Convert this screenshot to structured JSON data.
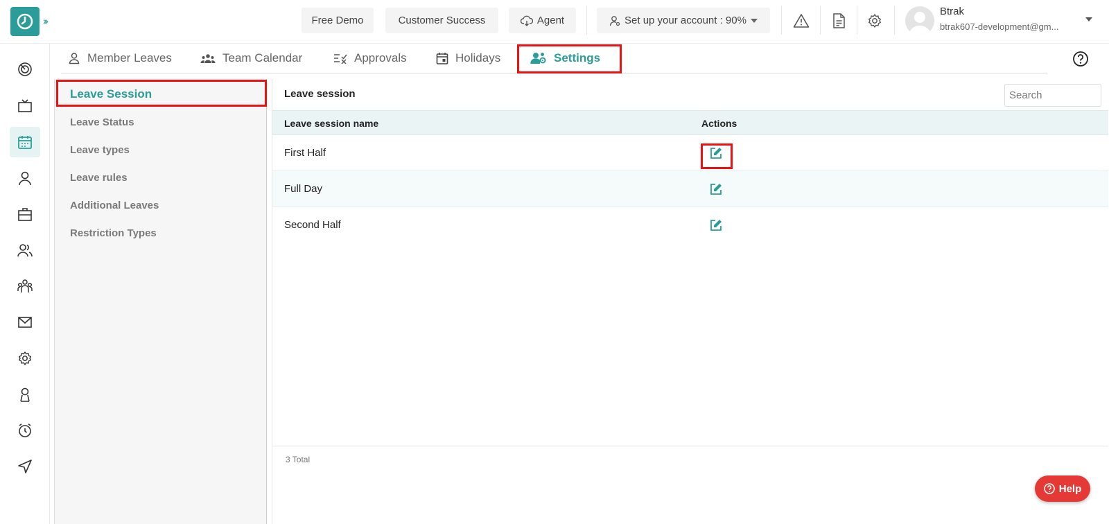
{
  "topbar": {
    "free_demo": "Free Demo",
    "customer_success": "Customer Success",
    "agent": "Agent",
    "setup": "Set up your account : 90%",
    "user_name": "Btrak",
    "user_email": "btrak607-development@gm..."
  },
  "tabs": [
    {
      "label": "Member Leaves",
      "icon": "person-icon"
    },
    {
      "label": "Team Calendar",
      "icon": "team-icon"
    },
    {
      "label": "Approvals",
      "icon": "approvals-icon"
    },
    {
      "label": "Holidays",
      "icon": "calendar-icon"
    },
    {
      "label": "Settings",
      "icon": "users-cog-icon",
      "active": true
    }
  ],
  "side_menu": [
    {
      "label": "Leave Session",
      "active": true
    },
    {
      "label": "Leave Status"
    },
    {
      "label": "Leave types"
    },
    {
      "label": "Leave rules"
    },
    {
      "label": "Additional Leaves"
    },
    {
      "label": "Restriction Types"
    }
  ],
  "panel": {
    "title": "Leave session",
    "search_placeholder": "Search",
    "columns": [
      "Leave session name",
      "Actions"
    ],
    "rows": [
      {
        "name": "First Half"
      },
      {
        "name": "Full Day"
      },
      {
        "name": "Second Half"
      }
    ],
    "total": "3 Total"
  },
  "help_label": "Help",
  "left_nav_icons": [
    "dashboard-icon",
    "tv-icon",
    "leave-calendar-icon",
    "user-icon",
    "briefcase-icon",
    "people-icon",
    "org-icon",
    "mail-icon",
    "settings-icon",
    "badge-icon",
    "alarm-icon",
    "send-icon"
  ],
  "colors": {
    "accent": "#2a9d9a",
    "highlight": "#e11111",
    "help": "#e53935"
  }
}
